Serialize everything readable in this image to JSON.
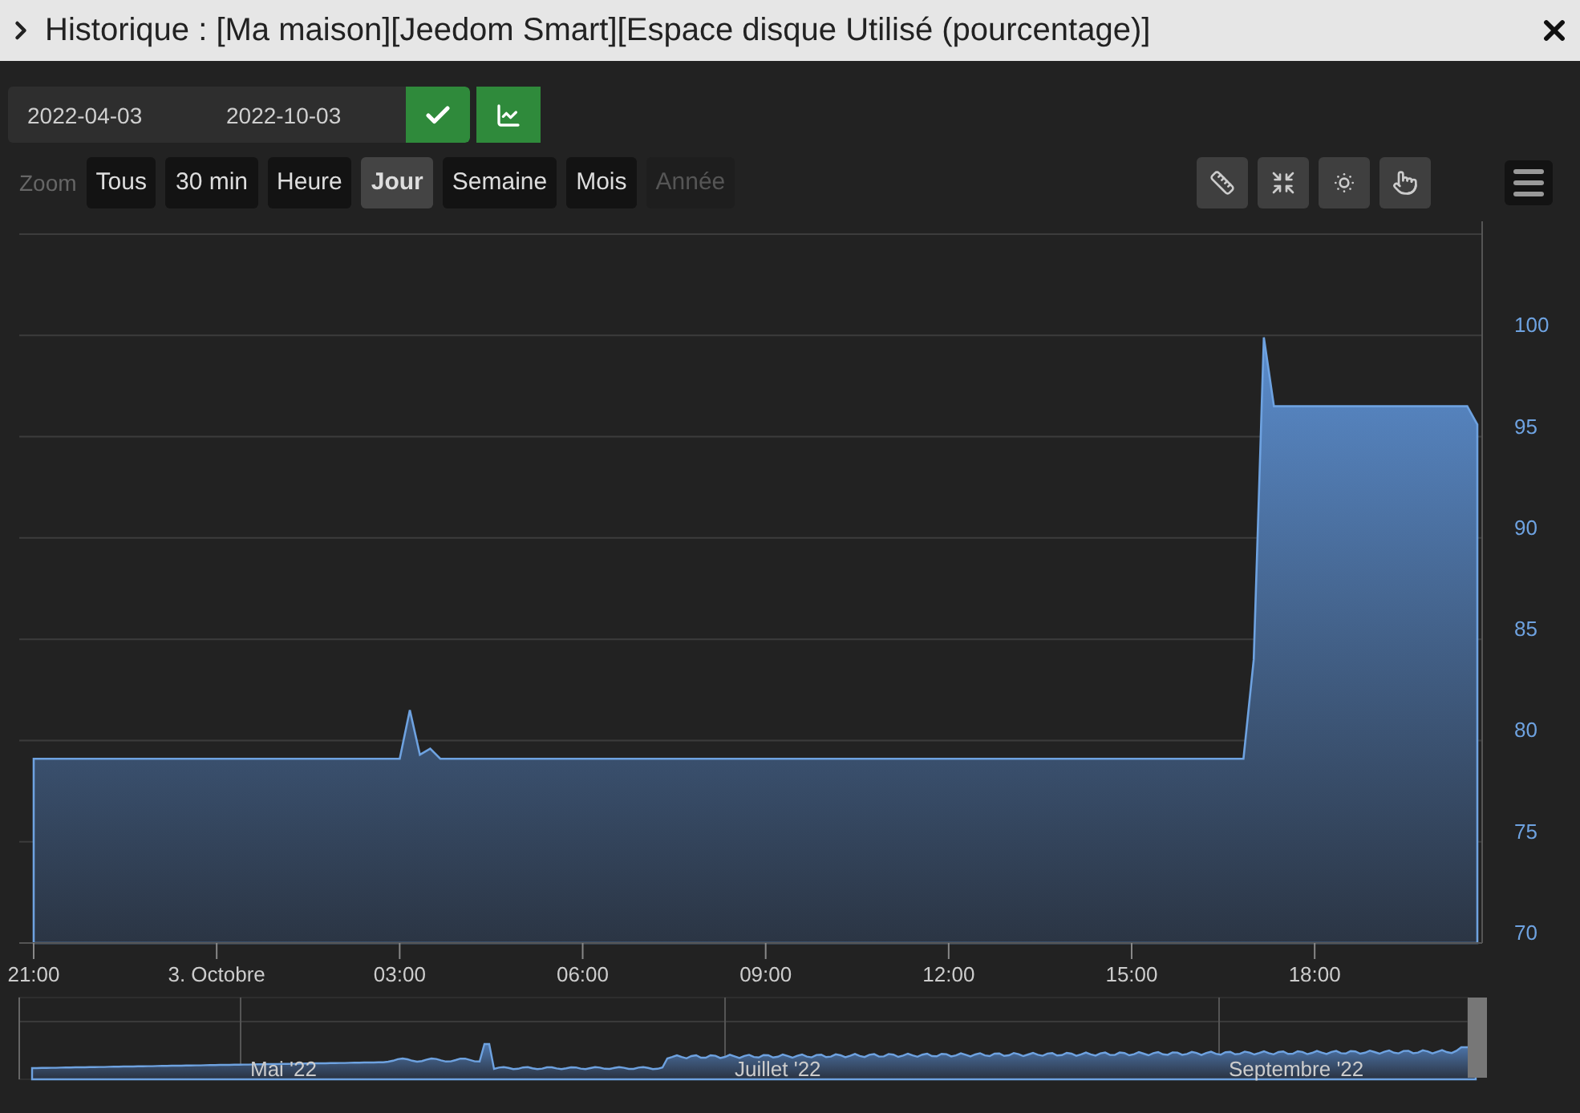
{
  "window": {
    "title": "Historique : [Ma maison][Jeedom Smart][Espace disque Utilisé (pourcentage)]"
  },
  "date_range": {
    "start": "2022-04-03",
    "end": "2022-10-03"
  },
  "zoom": {
    "label": "Zoom",
    "options": [
      {
        "label": "Tous",
        "selected": false,
        "disabled": false
      },
      {
        "label": "30 min",
        "selected": false,
        "disabled": false
      },
      {
        "label": "Heure",
        "selected": false,
        "disabled": false
      },
      {
        "label": "Jour",
        "selected": true,
        "disabled": false
      },
      {
        "label": "Semaine",
        "selected": false,
        "disabled": false
      },
      {
        "label": "Mois",
        "selected": false,
        "disabled": false
      },
      {
        "label": "Année",
        "selected": false,
        "disabled": true
      }
    ]
  },
  "chart_data": {
    "type": "area",
    "grid": true,
    "ylim": [
      70,
      105
    ],
    "yticks": [
      70,
      75,
      80,
      85,
      90,
      95,
      100
    ],
    "categories": [
      "21:00",
      null,
      null,
      null,
      null,
      null,
      null,
      null,
      null,
      null,
      null,
      null,
      null,
      null,
      null,
      null,
      null,
      null,
      "3. Octobre",
      null,
      null,
      null,
      null,
      null,
      null,
      null,
      null,
      null,
      null,
      null,
      null,
      null,
      null,
      null,
      null,
      null,
      "03:00",
      null,
      null,
      null,
      null,
      null,
      null,
      null,
      null,
      null,
      null,
      null,
      null,
      null,
      null,
      null,
      null,
      null,
      "06:00",
      null,
      null,
      null,
      null,
      null,
      null,
      null,
      null,
      null,
      null,
      null,
      null,
      null,
      null,
      null,
      null,
      null,
      "09:00",
      null,
      null,
      null,
      null,
      null,
      null,
      null,
      null,
      null,
      null,
      null,
      null,
      null,
      null,
      null,
      null,
      null,
      "12:00",
      null,
      null,
      null,
      null,
      null,
      null,
      null,
      null,
      null,
      null,
      null,
      null,
      null,
      null,
      null,
      null,
      null,
      "15:00",
      null,
      null,
      null,
      null,
      null,
      null,
      null,
      null,
      null,
      null,
      null,
      null,
      null,
      null,
      null,
      null,
      null,
      "18:00",
      null,
      null,
      null,
      null,
      null,
      null,
      null,
      null,
      null,
      null,
      null,
      null,
      null,
      null,
      null,
      null
    ],
    "series": [
      {
        "color": "#6ea2e0",
        "values": [
          79.1,
          79.1,
          79.1,
          79.1,
          79.1,
          79.1,
          79.1,
          79.1,
          79.1,
          79.1,
          79.1,
          79.1,
          79.1,
          79.1,
          79.1,
          79.1,
          79.1,
          79.1,
          79.1,
          79.1,
          79.1,
          79.1,
          79.1,
          79.1,
          79.1,
          79.1,
          79.1,
          79.1,
          79.1,
          79.1,
          79.1,
          79.1,
          79.1,
          79.1,
          79.1,
          79.1,
          79.1,
          81.5,
          79.3,
          79.6,
          79.1,
          79.1,
          79.1,
          79.1,
          79.1,
          79.1,
          79.1,
          79.1,
          79.1,
          79.1,
          79.1,
          79.1,
          79.1,
          79.1,
          79.1,
          79.1,
          79.1,
          79.1,
          79.1,
          79.1,
          79.1,
          79.1,
          79.1,
          79.1,
          79.1,
          79.1,
          79.1,
          79.1,
          79.1,
          79.1,
          79.1,
          79.1,
          79.1,
          79.1,
          79.1,
          79.1,
          79.1,
          79.1,
          79.1,
          79.1,
          79.1,
          79.1,
          79.1,
          79.1,
          79.1,
          79.1,
          79.1,
          79.1,
          79.1,
          79.1,
          79.1,
          79.1,
          79.1,
          79.1,
          79.1,
          79.1,
          79.1,
          79.1,
          79.1,
          79.1,
          79.1,
          79.1,
          79.1,
          79.1,
          79.1,
          79.1,
          79.1,
          79.1,
          79.1,
          79.1,
          79.1,
          79.1,
          79.1,
          79.1,
          79.1,
          79.1,
          79.1,
          79.1,
          79.1,
          79.1,
          84,
          99.9,
          96.5,
          96.5,
          96.5,
          96.5,
          96.5,
          96.5,
          96.5,
          96.5,
          96.5,
          96.5,
          96.5,
          96.5,
          96.5,
          96.5,
          96.5,
          96.5,
          96.5,
          96.5,
          96.5,
          96.5,
          95.6
        ]
      }
    ]
  },
  "navigator": {
    "labels": [
      "Mai '22",
      "Juillet '22",
      "Septembre '22"
    ]
  }
}
